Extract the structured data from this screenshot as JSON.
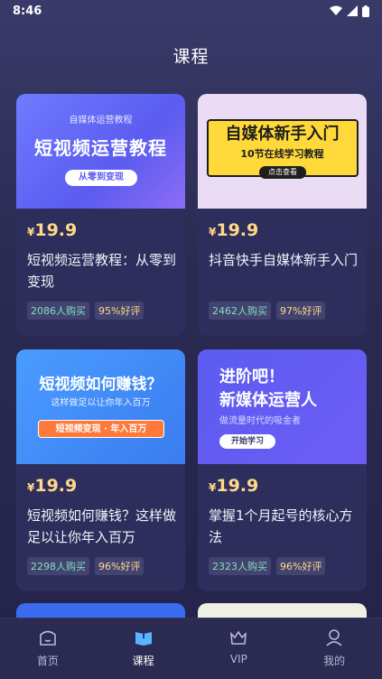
{
  "status": {
    "time": "8:46"
  },
  "header": {
    "title": "课程"
  },
  "courses": [
    {
      "thumb_sub": "自媒体运营教程",
      "thumb_main": "短视频运营教程",
      "thumb_btn": "从零到变现",
      "price_symbol": "¥",
      "price": "19.9",
      "title": "短视频运营教程：从零到变现",
      "buyers": "2086人购买",
      "rating": "95%好评"
    },
    {
      "thumb_main": "自媒体新手入门",
      "thumb_sub": "10节在线学习教程",
      "thumb_btn": "点击查看",
      "price_symbol": "¥",
      "price": "19.9",
      "title": "抖音快手自媒体新手入门",
      "buyers": "2462人购买",
      "rating": "97%好评"
    },
    {
      "thumb_main": "短视频如何赚钱？",
      "thumb_sub": "这样做足以让你年入百万",
      "thumb_btn": "短视频变现 · 年入百万",
      "price_symbol": "¥",
      "price": "19.9",
      "title": "短视频如何赚钱？这样做足以让你年入百万",
      "buyers": "2298人购买",
      "rating": "96%好评"
    },
    {
      "thumb_main1": "进阶吧！",
      "thumb_main2": "新媒体运营人",
      "thumb_sub": "做流量时代的吸金者",
      "thumb_btn": "开始学习",
      "price_symbol": "¥",
      "price": "19.9",
      "title": "掌握1个月起号的核心方法",
      "buyers": "2323人购买",
      "rating": "96%好评"
    }
  ],
  "tabs": [
    {
      "label": "首页",
      "icon": "home-icon"
    },
    {
      "label": "课程",
      "icon": "book-icon"
    },
    {
      "label": "VIP",
      "icon": "crown-icon"
    },
    {
      "label": "我的",
      "icon": "person-icon"
    }
  ]
}
